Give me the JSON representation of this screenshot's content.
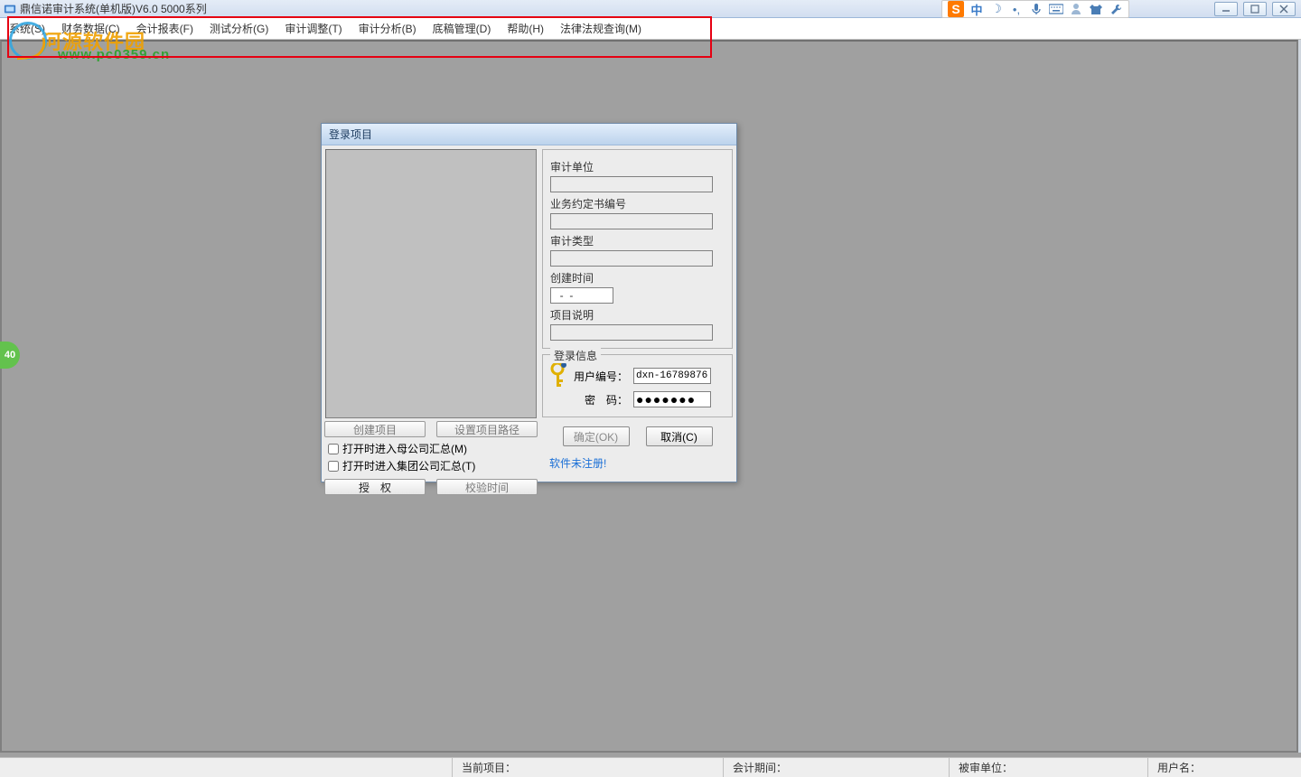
{
  "window": {
    "title": "鼎信诺审计系统(单机版)V6.0 5000系列"
  },
  "menu": {
    "items": [
      "系统(S)",
      "财务数据(C)",
      "会计报表(F)",
      "测试分析(G)",
      "审计调整(T)",
      "审计分析(B)",
      "底稿管理(D)",
      "帮助(H)",
      "法律法规查询(M)"
    ]
  },
  "watermark": {
    "text": "河源软件园",
    "url": "www.pc0359.cn"
  },
  "side_tab": {
    "label": "40"
  },
  "dialog": {
    "title": "登录项目",
    "fields": {
      "unit_label": "审计单位",
      "unit_value": "",
      "contract_label": "业务约定书编号",
      "contract_value": "",
      "type_label": "审计类型",
      "type_value": "",
      "create_label": "创建时间",
      "create_value": "  -  -",
      "desc_label": "项目说明",
      "desc_value": ""
    },
    "login": {
      "legend": "登录信息",
      "user_label": "用户编号：",
      "user_value": "dxn-16789876",
      "pw_label": "密　码：",
      "pw_value": "●●●●●●●"
    },
    "buttons": {
      "create": "创建项目",
      "setpath": "设置项目路径",
      "authorize": "授　权",
      "verify": "校验时间",
      "ok": "确定(OK)",
      "cancel": "取消(C)"
    },
    "checks": {
      "parent": "打开时进入母公司汇总(M)",
      "group": "打开时进入集团公司汇总(T)"
    },
    "unreg": "软件未注册!"
  },
  "ime": {
    "han": "中"
  },
  "statusbar": {
    "current": "当前项目：",
    "period": "会计期间：",
    "audited": "被审单位：",
    "user": "用户名："
  }
}
